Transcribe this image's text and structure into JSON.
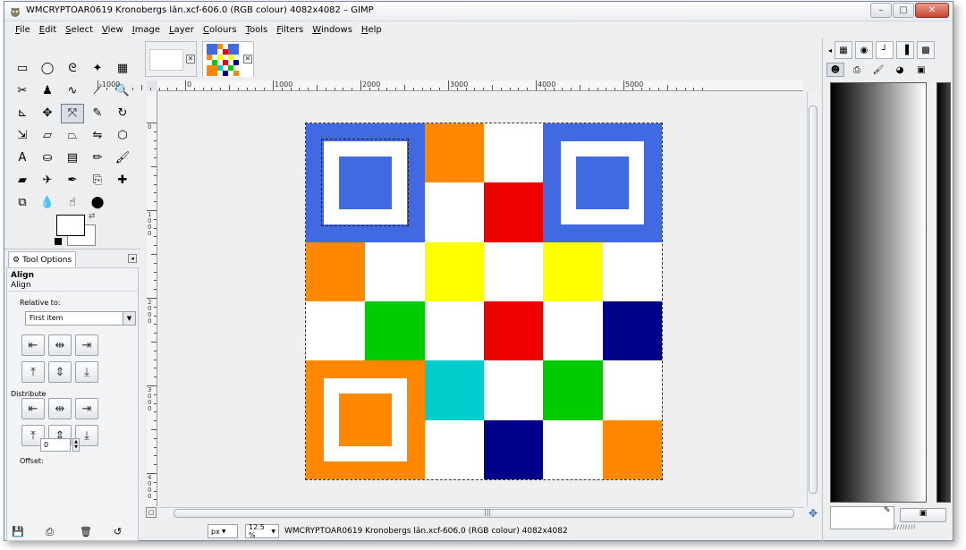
{
  "window": {
    "title": "WMCRYPTOAR0619 Kronobergs län.xcf-606.0 (RGB colour) 4082x4082 – GIMP",
    "minimize_label": "–",
    "maximize_label": "□",
    "close_label": "✕"
  },
  "menubar": [
    "File",
    "Edit",
    "Select",
    "View",
    "Image",
    "Layer",
    "Colours",
    "Tools",
    "Filters",
    "Windows",
    "Help"
  ],
  "toolbox": {
    "tools": [
      {
        "name": "rect-select-tool",
        "glyph": "▭"
      },
      {
        "name": "ellipse-select-tool",
        "glyph": "◯"
      },
      {
        "name": "free-select-tool",
        "glyph": "ᘓ"
      },
      {
        "name": "fuzzy-select-tool",
        "glyph": "✦"
      },
      {
        "name": "select-by-color-tool",
        "glyph": "▦"
      },
      {
        "name": "scissors-select-tool",
        "glyph": "✂"
      },
      {
        "name": "foreground-select-tool",
        "glyph": "♟"
      },
      {
        "name": "paths-tool",
        "glyph": "∿"
      },
      {
        "name": "color-picker-tool",
        "glyph": "⟋"
      },
      {
        "name": "zoom-tool",
        "glyph": "🔍"
      },
      {
        "name": "measure-tool",
        "glyph": "⊾"
      },
      {
        "name": "move-tool",
        "glyph": "✥"
      },
      {
        "name": "align-tool",
        "glyph": "⤧"
      },
      {
        "name": "crop-tool",
        "glyph": "✎"
      },
      {
        "name": "rotate-tool",
        "glyph": "↻"
      },
      {
        "name": "scale-tool",
        "glyph": "⇲"
      },
      {
        "name": "shear-tool",
        "glyph": "▱"
      },
      {
        "name": "perspective-tool",
        "glyph": "⏢"
      },
      {
        "name": "flip-tool",
        "glyph": "⇋"
      },
      {
        "name": "cage-transform-tool",
        "glyph": "⬡"
      },
      {
        "name": "text-tool",
        "glyph": "A"
      },
      {
        "name": "bucket-fill-tool",
        "glyph": "⛀"
      },
      {
        "name": "blend-tool",
        "glyph": "▤"
      },
      {
        "name": "pencil-tool",
        "glyph": "✏"
      },
      {
        "name": "paintbrush-tool",
        "glyph": "🖌"
      },
      {
        "name": "eraser-tool",
        "glyph": "▰"
      },
      {
        "name": "airbrush-tool",
        "glyph": "✈"
      },
      {
        "name": "ink-tool",
        "glyph": "✒"
      },
      {
        "name": "clone-tool",
        "glyph": "⎘"
      },
      {
        "name": "heal-tool",
        "glyph": "✚"
      },
      {
        "name": "perspective-clone-tool",
        "glyph": "⧉"
      },
      {
        "name": "blur-sharpen-tool",
        "glyph": "💧"
      },
      {
        "name": "smudge-tool",
        "glyph": "☝"
      },
      {
        "name": "dodge-burn-tool",
        "glyph": "⬤"
      }
    ]
  },
  "tool_options": {
    "tab_label": "Tool Options",
    "title": "Align",
    "subtitle": "Align",
    "relative_to_label": "Relative to:",
    "relative_to_value": "First item",
    "distribute_label": "Distribute",
    "offset_label": "Offset:",
    "offset_value": "0"
  },
  "image_tabs": [
    {
      "name": "blank-image-tab"
    },
    {
      "name": "qr-image-tab"
    }
  ],
  "rulers": {
    "h_labels": [
      "-1000",
      "0",
      "1000",
      "2000",
      "3000",
      "4000",
      "5000"
    ],
    "v_labels": [
      "0",
      "1000",
      "2000",
      "3000",
      "4000"
    ]
  },
  "qr": {
    "colors": {
      "blue": "#4169e1",
      "orange": "#ff8800",
      "red": "#ee0000",
      "yellow": "#ffff00",
      "green": "#00cc00",
      "navy": "#000088",
      "cyan": "#00cccc",
      "white": "#ffffff"
    },
    "grid": [
      [
        "F",
        "F",
        "orange",
        "white",
        "F",
        "F"
      ],
      [
        "F",
        "F",
        "white",
        "red",
        "F",
        "F"
      ],
      [
        "orange",
        "white",
        "yellow",
        "white",
        "yellow",
        "white"
      ],
      [
        "white",
        "green",
        "white",
        "red",
        "white",
        "navy"
      ],
      [
        "F",
        "F",
        "cyan",
        "white",
        "green",
        "white"
      ],
      [
        "F",
        "F",
        "white",
        "navy",
        "white",
        "orange"
      ]
    ],
    "finders": [
      {
        "pos": "top-left",
        "color": "blue"
      },
      {
        "pos": "top-right",
        "color": "blue"
      },
      {
        "pos": "bottom-left",
        "color": "orange"
      }
    ]
  },
  "statusbar": {
    "unit": "px",
    "zoom": "12.5 %",
    "text": "WMCRYPTOAR0619 Kronobergs län.xcf-606.0 (RGB colour) 4082x4082"
  }
}
